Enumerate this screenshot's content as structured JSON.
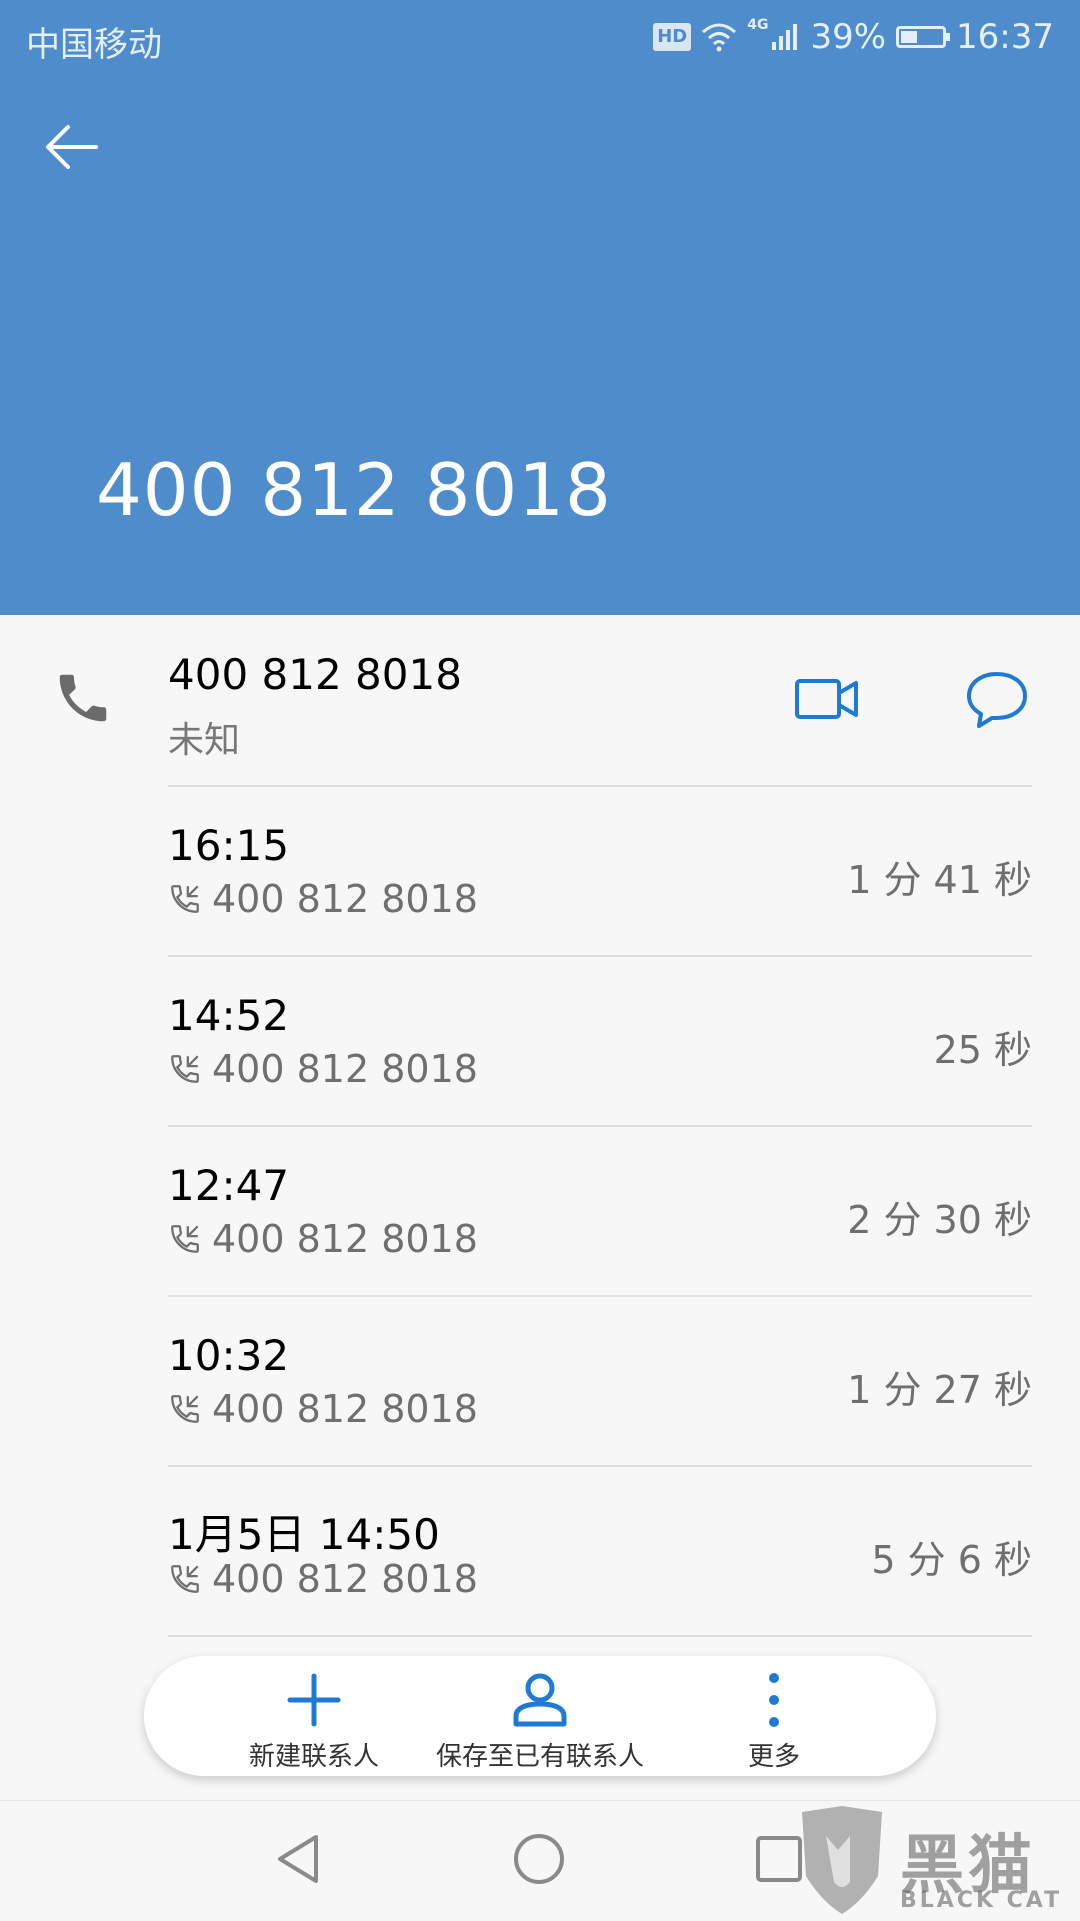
{
  "status_bar": {
    "carrier": "中国移动",
    "hd": "HD",
    "network": "4G",
    "battery": "39%",
    "battery_level": 0.39,
    "time": "16:37"
  },
  "header": {
    "title_number": "400 812 8018"
  },
  "contact": {
    "number": "400 812 8018",
    "type": "未知"
  },
  "calls": [
    {
      "time": "16:15",
      "number": "400 812 8018",
      "duration": "1 分 41 秒"
    },
    {
      "time": "14:52",
      "number": "400 812 8018",
      "duration": "25 秒"
    },
    {
      "time": "12:47",
      "number": "400 812 8018",
      "duration": "2 分 30 秒"
    },
    {
      "time": "10:32",
      "number": "400 812 8018",
      "duration": "1 分 27 秒"
    },
    {
      "time": "1月5日 14:50",
      "number": "400 812 8018",
      "duration": "5 分 6 秒"
    }
  ],
  "actions": {
    "new_contact": "新建联系人",
    "save_existing": "保存至已有联系人",
    "more": "更多"
  },
  "watermark": {
    "text": "黑猫",
    "sub": "BLACK CAT"
  },
  "colors": {
    "header_bg": "#4f8ccb",
    "accent": "#1f7ad6"
  }
}
